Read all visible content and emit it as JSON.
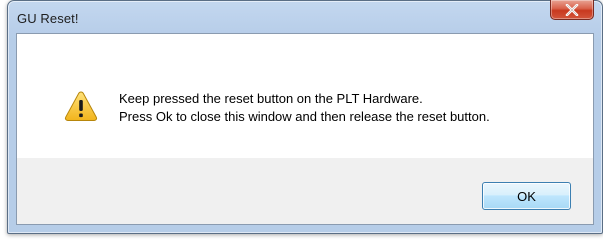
{
  "window": {
    "title": "GU Reset!"
  },
  "title_bar": {
    "close_icon": "close-icon"
  },
  "message": {
    "icon": "warning-icon",
    "line1": "Keep pressed the reset button on the PLT Hardware.",
    "line2": "Press Ok to close this window and then release the reset button."
  },
  "buttons": {
    "ok_label": "OK"
  },
  "colors": {
    "close_button": "#d3553b",
    "ok_button_border": "#3c7fb1",
    "warning_fill": "#f8c62c"
  }
}
